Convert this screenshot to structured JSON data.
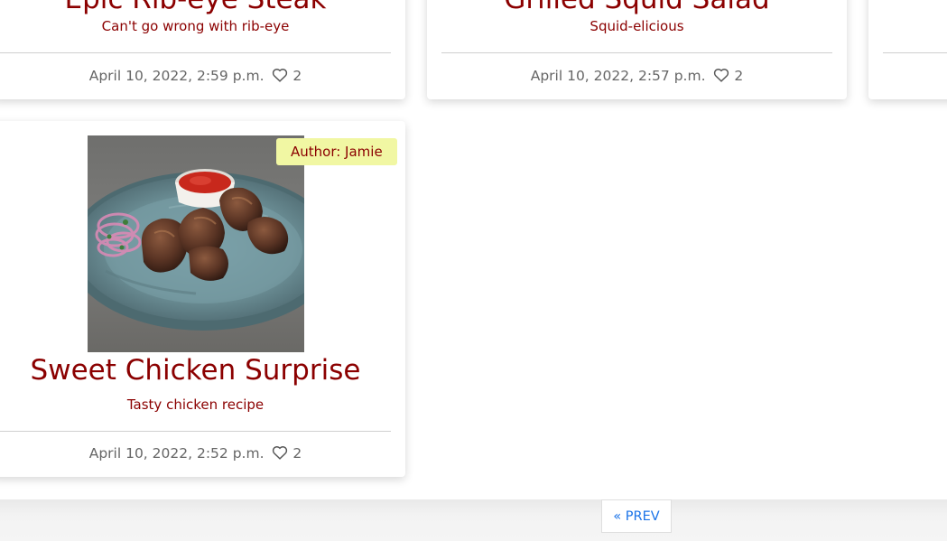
{
  "cards": [
    {
      "title": "Epic Rib-eye Steak",
      "excerpt": "Can't go wrong with rib-eye",
      "date": "April 10, 2022, 2:59 p.m.",
      "likes": "2"
    },
    {
      "title": "Grilled Squid Salad",
      "excerpt": "Squid-elicious",
      "date": "April 10, 2022, 2:57 p.m.",
      "likes": "2"
    },
    {
      "title": "Sweet Chicken Surprise",
      "excerpt": "Tasty chicken recipe",
      "date": "April 10, 2022, 2:52 p.m.",
      "likes": "2",
      "author": "Author: Jamie",
      "image_icon": "recipe-photo-grilled-meat"
    }
  ],
  "pagination": {
    "prev_label": "« PREV"
  },
  "colors": {
    "title": "#8b0000",
    "meta": "#666666",
    "badge_bg": "#f1f7a3",
    "link": "#1a73e8"
  }
}
